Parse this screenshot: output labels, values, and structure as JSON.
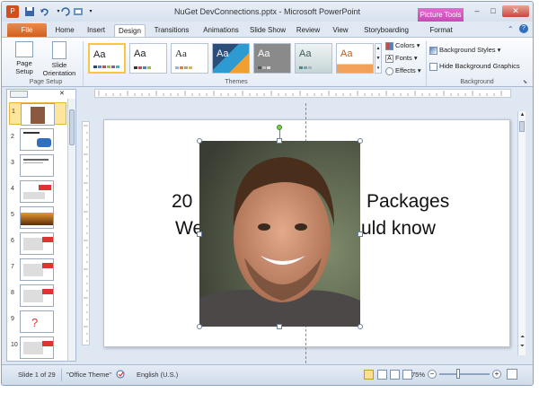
{
  "window": {
    "title": "NuGet DevConnections.pptx - Microsoft PowerPoint",
    "context_tab_group": "Picture Tools",
    "min_symbol": "–",
    "max_symbol": "□",
    "close_symbol": "✕"
  },
  "tabs": [
    "File",
    "Home",
    "Insert",
    "Design",
    "Transitions",
    "Animations",
    "Slide Show",
    "Review",
    "View",
    "Storyboarding",
    "Format"
  ],
  "active_tab": "Design",
  "ribbon": {
    "page_setup": {
      "page_setup_label": "Page Setup",
      "orientation_label": "Slide Orientation",
      "group_label": "Page Setup"
    },
    "themes": {
      "group_label": "Themes",
      "sample_text": "Aa",
      "colors_label": "Colors",
      "fonts_label": "Fonts",
      "effects_label": "Effects"
    },
    "background": {
      "styles_label": "Background Styles",
      "hide_graphics_label": "Hide Background Graphics",
      "group_label": "Background"
    }
  },
  "thumbnails": [
    "1",
    "2",
    "3",
    "4",
    "5",
    "6",
    "7",
    "8",
    "9",
    "10"
  ],
  "selected_slide": "1",
  "slide": {
    "title_line1_left": "20",
    "title_line1_right": "Packages",
    "title_line2_left": "We",
    "title_line2_right": "uld know"
  },
  "status": {
    "slide_info": "Slide 1 of 29",
    "theme": "\"Office Theme\"",
    "language": "English (U.S.)",
    "zoom": "75%",
    "zoom_out": "−",
    "zoom_in": "+"
  },
  "colors": {
    "file_tab": "#d2601d",
    "context_tab": "#c849b6",
    "ribbon_bg": "#eef3fa",
    "selection": "#f6c83f"
  }
}
